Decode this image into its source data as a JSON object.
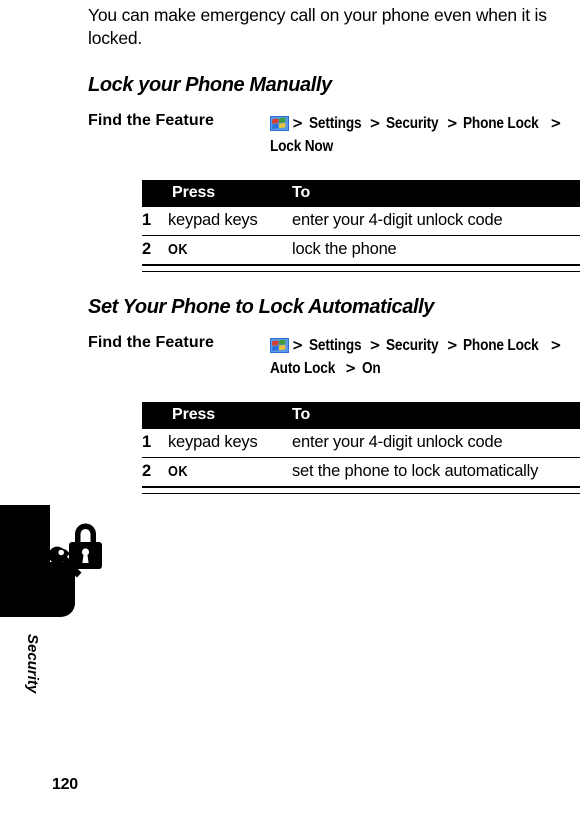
{
  "page": {
    "number": "120",
    "intro_paragraph": "You can make emergency call on your phone even when it is locked."
  },
  "side_tab": {
    "label": "Security",
    "icon": "padlock-key-icon"
  },
  "sections": [
    {
      "heading": "Lock your Phone Manually",
      "feature": {
        "label": "Find the Feature",
        "icon": "main-menu-icon",
        "path": [
          "Settings",
          "Security",
          "Phone Lock",
          "Lock Now"
        ],
        "separator": ">"
      },
      "table": {
        "headers": [
          "",
          "Press",
          "To"
        ],
        "rows": [
          {
            "num": "1",
            "press": "keypad keys",
            "press_style": "normal",
            "to": "enter your 4-digit unlock code"
          },
          {
            "num": "2",
            "press": "OK",
            "press_style": "key",
            "to": "lock the phone"
          }
        ]
      }
    },
    {
      "heading": "Set Your Phone to Lock Automatically",
      "feature": {
        "label": "Find the Feature",
        "icon": "main-menu-icon",
        "path": [
          "Settings",
          "Security",
          "Phone Lock",
          "Auto Lock",
          "On"
        ],
        "separator": ">"
      },
      "table": {
        "headers": [
          "",
          "Press",
          "To"
        ],
        "rows": [
          {
            "num": "1",
            "press": "keypad keys",
            "press_style": "normal",
            "to": "enter your 4-digit unlock code"
          },
          {
            "num": "2",
            "press": "OK",
            "press_style": "key",
            "to": "set the phone to lock automatically"
          }
        ]
      }
    }
  ],
  "colors": {
    "text": "#000000",
    "header_bg": "#000000",
    "header_text": "#ffffff",
    "page_bg": "#ffffff",
    "icon_blue": "#2a6fd6",
    "icon_red": "#d63c2a",
    "icon_green": "#3c9e3c",
    "icon_yellow": "#e8c23a"
  }
}
